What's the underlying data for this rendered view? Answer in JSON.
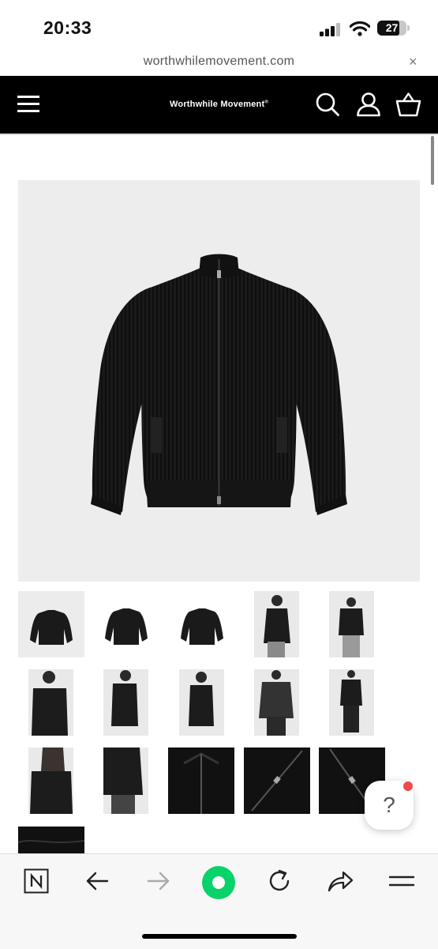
{
  "status_bar": {
    "time": "20:33",
    "battery_level": "27",
    "icons": [
      "cellular-signal-icon",
      "wifi-icon",
      "battery-icon"
    ]
  },
  "browser": {
    "url": "worthwhilemovement.com",
    "close_label": "×"
  },
  "site_header": {
    "brand": "Worthwhile Movement",
    "brand_mark": "®",
    "icons": [
      "menu-icon",
      "search-icon",
      "account-icon",
      "cart-icon"
    ]
  },
  "product": {
    "main_image_icon": "black-knit-zip-cardigan-image",
    "thumbnails": [
      {
        "icon": "cardigan-front-thumbnail",
        "tone": "light"
      },
      {
        "icon": "cardigan-back-thumbnail",
        "tone": "light"
      },
      {
        "icon": "cardigan-flat-thumbnail",
        "tone": "light"
      },
      {
        "icon": "model-front-thumbnail",
        "tone": "photo"
      },
      {
        "icon": "model-open-thumbnail",
        "tone": "photo"
      },
      {
        "icon": "model-closeup-thumbnail",
        "tone": "photo"
      },
      {
        "icon": "model-side-thumbnail",
        "tone": "photo"
      },
      {
        "icon": "model-back-thumbnail",
        "tone": "photo"
      },
      {
        "icon": "model-layered-thumbnail",
        "tone": "photo"
      },
      {
        "icon": "model-full-thumbnail",
        "tone": "photo"
      },
      {
        "icon": "model-hair-thumbnail",
        "tone": "photo"
      },
      {
        "icon": "model-arm-thumbnail",
        "tone": "photo"
      },
      {
        "icon": "collar-detail-thumbnail",
        "tone": "dark"
      },
      {
        "icon": "zipper-detail-thumbnail",
        "tone": "dark"
      },
      {
        "icon": "zipper-pull-thumbnail",
        "tone": "dark"
      },
      {
        "icon": "knit-texture-thumbnail",
        "tone": "dark"
      }
    ]
  },
  "help_button": {
    "label": "?",
    "has_notification": true,
    "notification_color": "#ee4a4a"
  },
  "bottom_toolbar": {
    "items": [
      "naver-icon",
      "back-arrow-icon",
      "forward-arrow-icon",
      "green-dot-icon",
      "reload-icon",
      "share-icon",
      "menu-lines-icon"
    ],
    "accent_color": "#08d26a"
  }
}
